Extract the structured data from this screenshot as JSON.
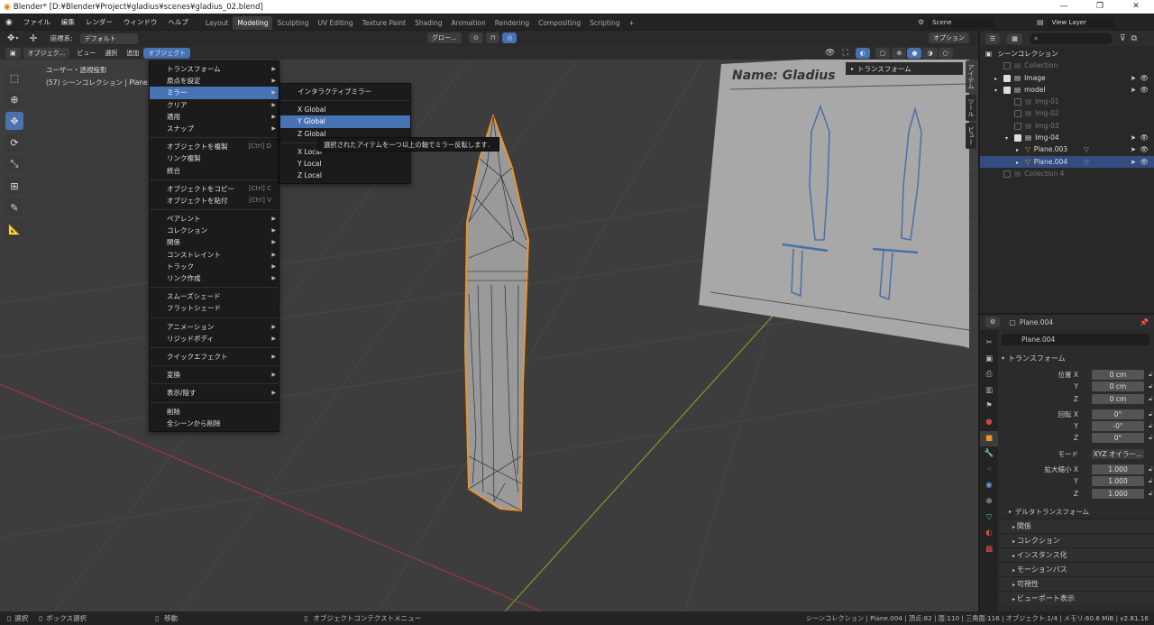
{
  "title_bar": {
    "title": "Blender* [D:¥Blender¥Project¥gladius¥scenes¥gladius_02.blend]",
    "minimize": "—",
    "maximize": "❐",
    "close": "✕"
  },
  "menubar": {
    "items": [
      "ファイル",
      "編集",
      "レンダー",
      "ウィンドウ",
      "ヘルプ"
    ],
    "workspaces": [
      "Layout",
      "Modeling",
      "Sculpting",
      "UV Editing",
      "Texture Paint",
      "Shading",
      "Animation",
      "Rendering",
      "Compositing",
      "Scripting"
    ],
    "active_workspace": "Modeling",
    "add_workspace": "+",
    "scene": "Scene",
    "view_layer": "View Layer"
  },
  "tool_header": {
    "coord_label": "座標系:",
    "coord_value": "デフォルト",
    "transform_orientation": "グロー...",
    "options": "オプション"
  },
  "viewport_header": {
    "mode": "オブジェク...",
    "items": [
      "ビュー",
      "選択",
      "追加",
      "オブジェクト"
    ],
    "active_item": "オブジェクト"
  },
  "viewport": {
    "view_name": "ユーザー・透視投影",
    "collection_info": "(57) シーンコレクション | Plane.004",
    "reference_text": "Name: Gladius",
    "n_panel_header": "トランスフォーム",
    "side_tabs": [
      "アイテム",
      "ツール",
      "ビュー"
    ]
  },
  "object_menu": {
    "items": [
      {
        "label": "トランスフォーム",
        "arrow": true
      },
      {
        "label": "原点を設定",
        "arrow": true
      },
      {
        "label": "ミラー",
        "arrow": true,
        "hl": true
      },
      {
        "label": "クリア",
        "arrow": true
      },
      {
        "label": "適用",
        "arrow": true
      },
      {
        "label": "スナップ",
        "arrow": true
      },
      {
        "sep": true
      },
      {
        "label": "オブジェクトを複製",
        "shortcut": "[Ctrl] D"
      },
      {
        "label": "リンク複製"
      },
      {
        "label": "統合"
      },
      {
        "sep": true
      },
      {
        "label": "オブジェクトをコピー",
        "shortcut": "[Ctrl] C"
      },
      {
        "label": "オブジェクトを貼付",
        "shortcut": "[Ctrl] V"
      },
      {
        "sep": true
      },
      {
        "label": "ペアレント",
        "arrow": true
      },
      {
        "label": "コレクション",
        "arrow": true
      },
      {
        "label": "関係",
        "arrow": true
      },
      {
        "label": "コンストレイント",
        "arrow": true
      },
      {
        "label": "トラック",
        "arrow": true
      },
      {
        "label": "リンク作成",
        "arrow": true
      },
      {
        "sep": true
      },
      {
        "label": "スムーズシェード"
      },
      {
        "label": "フラットシェード"
      },
      {
        "sep": true
      },
      {
        "label": "アニメーション",
        "arrow": true
      },
      {
        "label": "リジッドボディ",
        "arrow": true
      },
      {
        "sep": true
      },
      {
        "label": "クイックエフェクト",
        "arrow": true
      },
      {
        "sep": true
      },
      {
        "label": "変換",
        "arrow": true
      },
      {
        "sep": true
      },
      {
        "label": "表示/隠す",
        "arrow": true
      },
      {
        "sep": true
      },
      {
        "label": "削除"
      },
      {
        "label": "全シーンから削除"
      }
    ]
  },
  "mirror_submenu": {
    "items": [
      {
        "label": "インタラクティブミラー"
      },
      {
        "sep": true
      },
      {
        "label": "X Global"
      },
      {
        "label": "Y Global",
        "hl": true
      },
      {
        "label": "Z Global"
      },
      {
        "sep": true
      },
      {
        "label": "X Local"
      },
      {
        "label": "Y Local"
      },
      {
        "label": "Z Local"
      }
    ],
    "tooltip": "選択されたアイテムを一つ以上の軸でミラー反転します."
  },
  "outliner": {
    "root": "シーンコレクション",
    "rows": [
      {
        "label": "Collection",
        "indent": 1,
        "dim": true,
        "cb": false
      },
      {
        "label": "Image",
        "indent": 1,
        "cb": true,
        "expand": "▸"
      },
      {
        "label": "model",
        "indent": 1,
        "cb": true,
        "expand": "▾"
      },
      {
        "label": "Img-01",
        "indent": 2,
        "dim": true,
        "cb": false
      },
      {
        "label": "Img-02",
        "indent": 2,
        "dim": true,
        "cb": false
      },
      {
        "label": "Img-03",
        "indent": 2,
        "dim": true,
        "cb": false
      },
      {
        "label": "Img-04",
        "indent": 2,
        "cb": true,
        "expand": "▾"
      },
      {
        "label": "Plane.003",
        "indent": 3,
        "expand": "▸"
      },
      {
        "label": "Plane.004",
        "indent": 3,
        "expand": "▸",
        "sel": true
      },
      {
        "label": "Collection 4",
        "indent": 1,
        "dim": true,
        "cb": false
      }
    ]
  },
  "properties": {
    "header_object": "Plane.004",
    "object_name": "Plane.004",
    "transform_title": "トランスフォーム",
    "location": {
      "label": "位置 X",
      "x": "0 cm",
      "y": "0 cm",
      "z": "0 cm"
    },
    "rotation": {
      "label": "回転 X",
      "x": "0°",
      "y": "-0°",
      "z": "0°"
    },
    "mode_label": "モード",
    "mode_value": "XYZ オイラー...",
    "scale": {
      "label": "拡大縮小 X",
      "x": "1.000",
      "y": "1.000",
      "z": "1.000"
    },
    "axis_y": "Y",
    "axis_z": "Z",
    "delta": "デルタトランスフォーム",
    "panels": [
      "関係",
      "コレクション",
      "インスタンス化",
      "モーションパス",
      "可視性",
      "ビューポート表示"
    ]
  },
  "status_bar": {
    "select": "選択",
    "box_select": "ボックス選択",
    "move": "移動",
    "context_menu": "オブジェクトコンテクストメニュー",
    "stats": "シーンコレクション | Plane.004 | 頂点:82 | 面:110 | 三角面:116 | オブジェクト:1/4 | メモリ:60.6 MiB | v2.81.16"
  },
  "colors": {
    "selection_outline": "#e8952c",
    "highlight": "#4772b3",
    "viewport_bg": "#3d3d3d"
  }
}
